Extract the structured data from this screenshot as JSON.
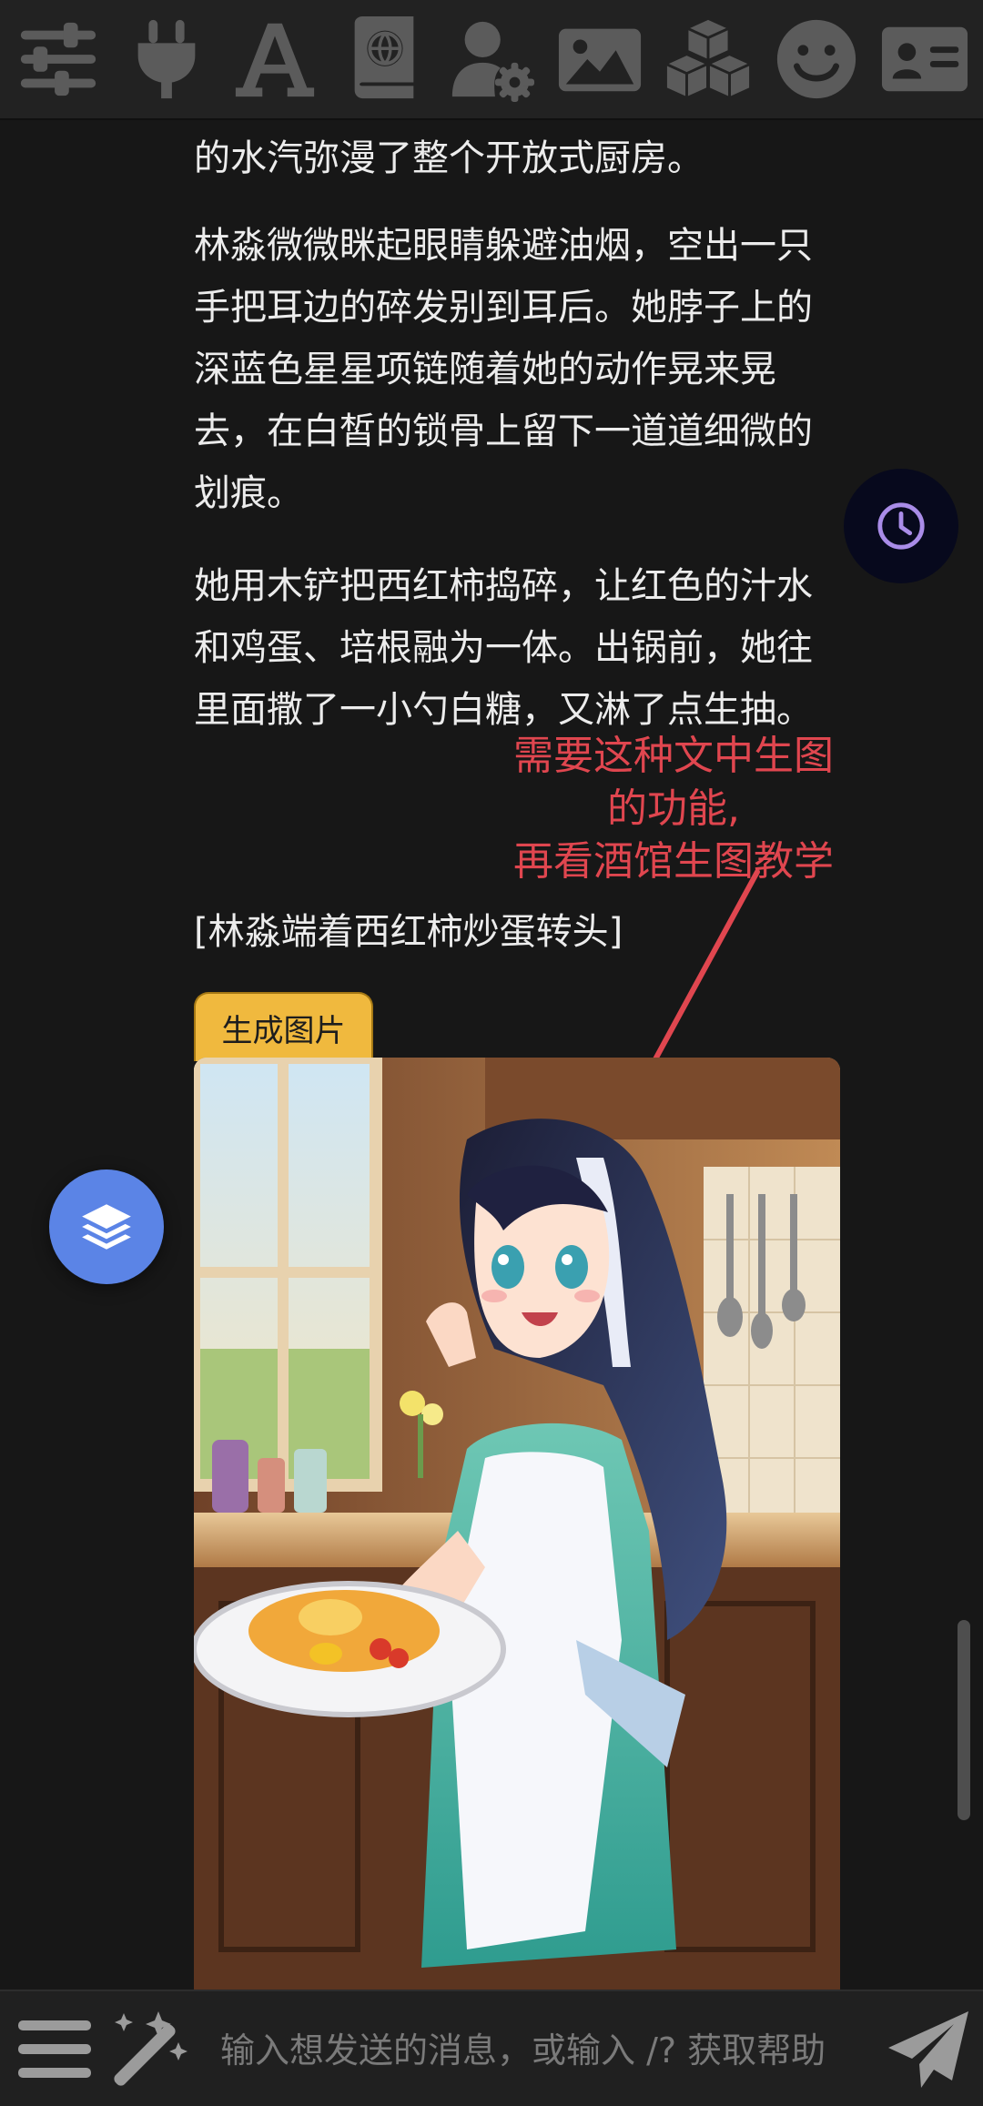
{
  "toolbar": {
    "icons": [
      "sliders-icon",
      "plug-icon",
      "font-icon",
      "book-globe-icon",
      "user-cog-icon",
      "image-icon",
      "cubes-icon",
      "smile-icon",
      "id-card-icon"
    ]
  },
  "chat": {
    "paragraphs": [
      "的水汽弥漫了整个开放式厨房。",
      "林淼微微眯起眼睛躲避油烟，空出一只手把耳边的碎发别到耳后。她脖子上的深蓝色星星项链随着她的动作晃来晃去，在白皙的锁骨上留下一道道细微的划痕。",
      "她用木铲把西红柿捣碎，让红色的汁水和鸡蛋、培根融为一体。出锅前，她往里面撒了一小勺白糖，又淋了点生抽。",
      "[林淼端着西红柿炒蛋转头]"
    ],
    "generate_image_label": "生成图片"
  },
  "annotation": {
    "lines": [
      "需要这种文中生图",
      "的功能,",
      "再看酒馆生图教学"
    ],
    "color": "#e0464f"
  },
  "input": {
    "placeholder": "输入想发送的消息，或输入 /? 获取帮助"
  },
  "colors": {
    "background": "#171717",
    "toolbar": "#222222",
    "tag": "#f0b93e",
    "fab_layers": "#5b84e6",
    "fab_history_icon": "#a98ce8"
  }
}
